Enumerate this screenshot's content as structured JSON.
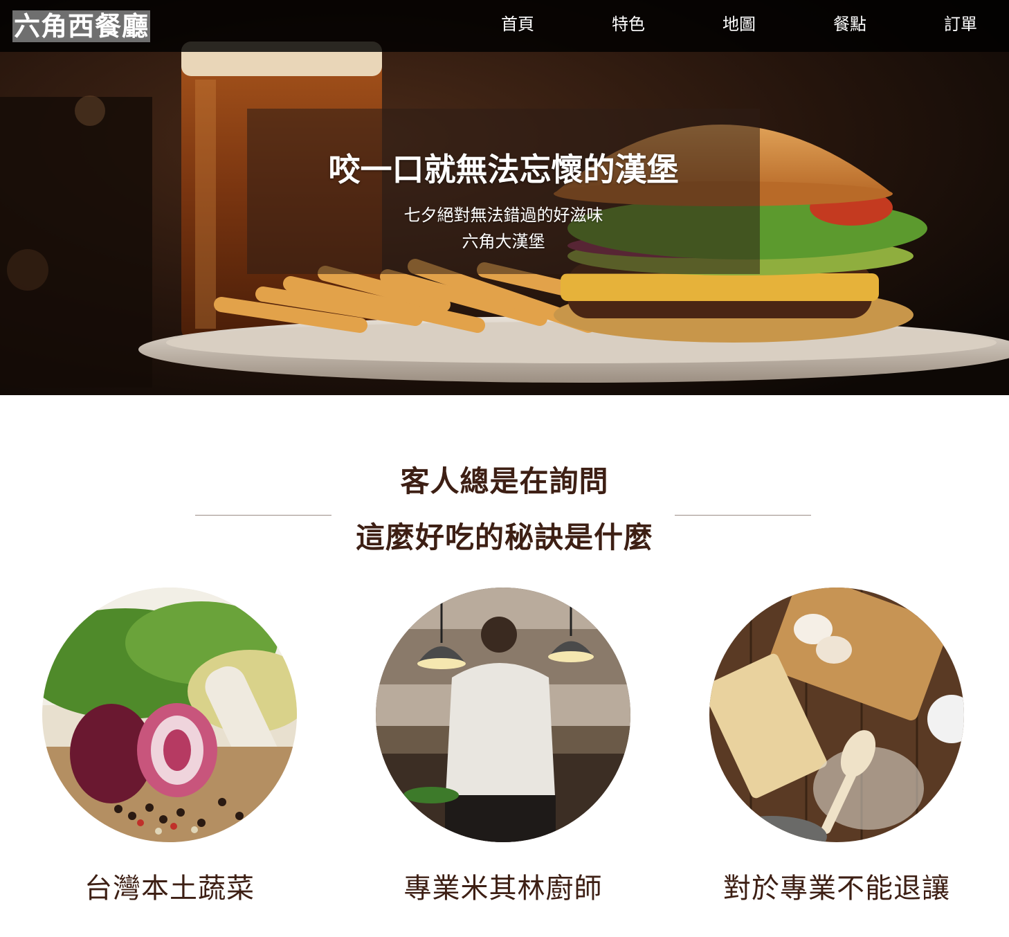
{
  "navbar": {
    "brand": "六角西餐廳",
    "items": [
      "首頁",
      "特色",
      "地圖",
      "餐點",
      "訂單"
    ]
  },
  "hero": {
    "title": "咬一口就無法忘懷的漢堡",
    "subtitle_line1": "七夕絕對無法錯過的好滋味",
    "subtitle_line2": "六角大漢堡"
  },
  "features": {
    "heading_line1": "客人總是在詢問",
    "heading_line2": "這麼好吃的秘訣是什麼",
    "items": [
      {
        "caption": "台灣本土蔬菜",
        "icon": "vegetables-photo"
      },
      {
        "caption": "專業米其林廚師",
        "icon": "chef-kitchen-photo"
      },
      {
        "caption": "對於專業不能退讓",
        "icon": "baking-ingredients-photo"
      }
    ]
  },
  "colors": {
    "navbar_bg": "#000000",
    "brand_bg": "#6f6f6f",
    "heading_text": "#3d1f14",
    "divider": "#9a8d86"
  }
}
